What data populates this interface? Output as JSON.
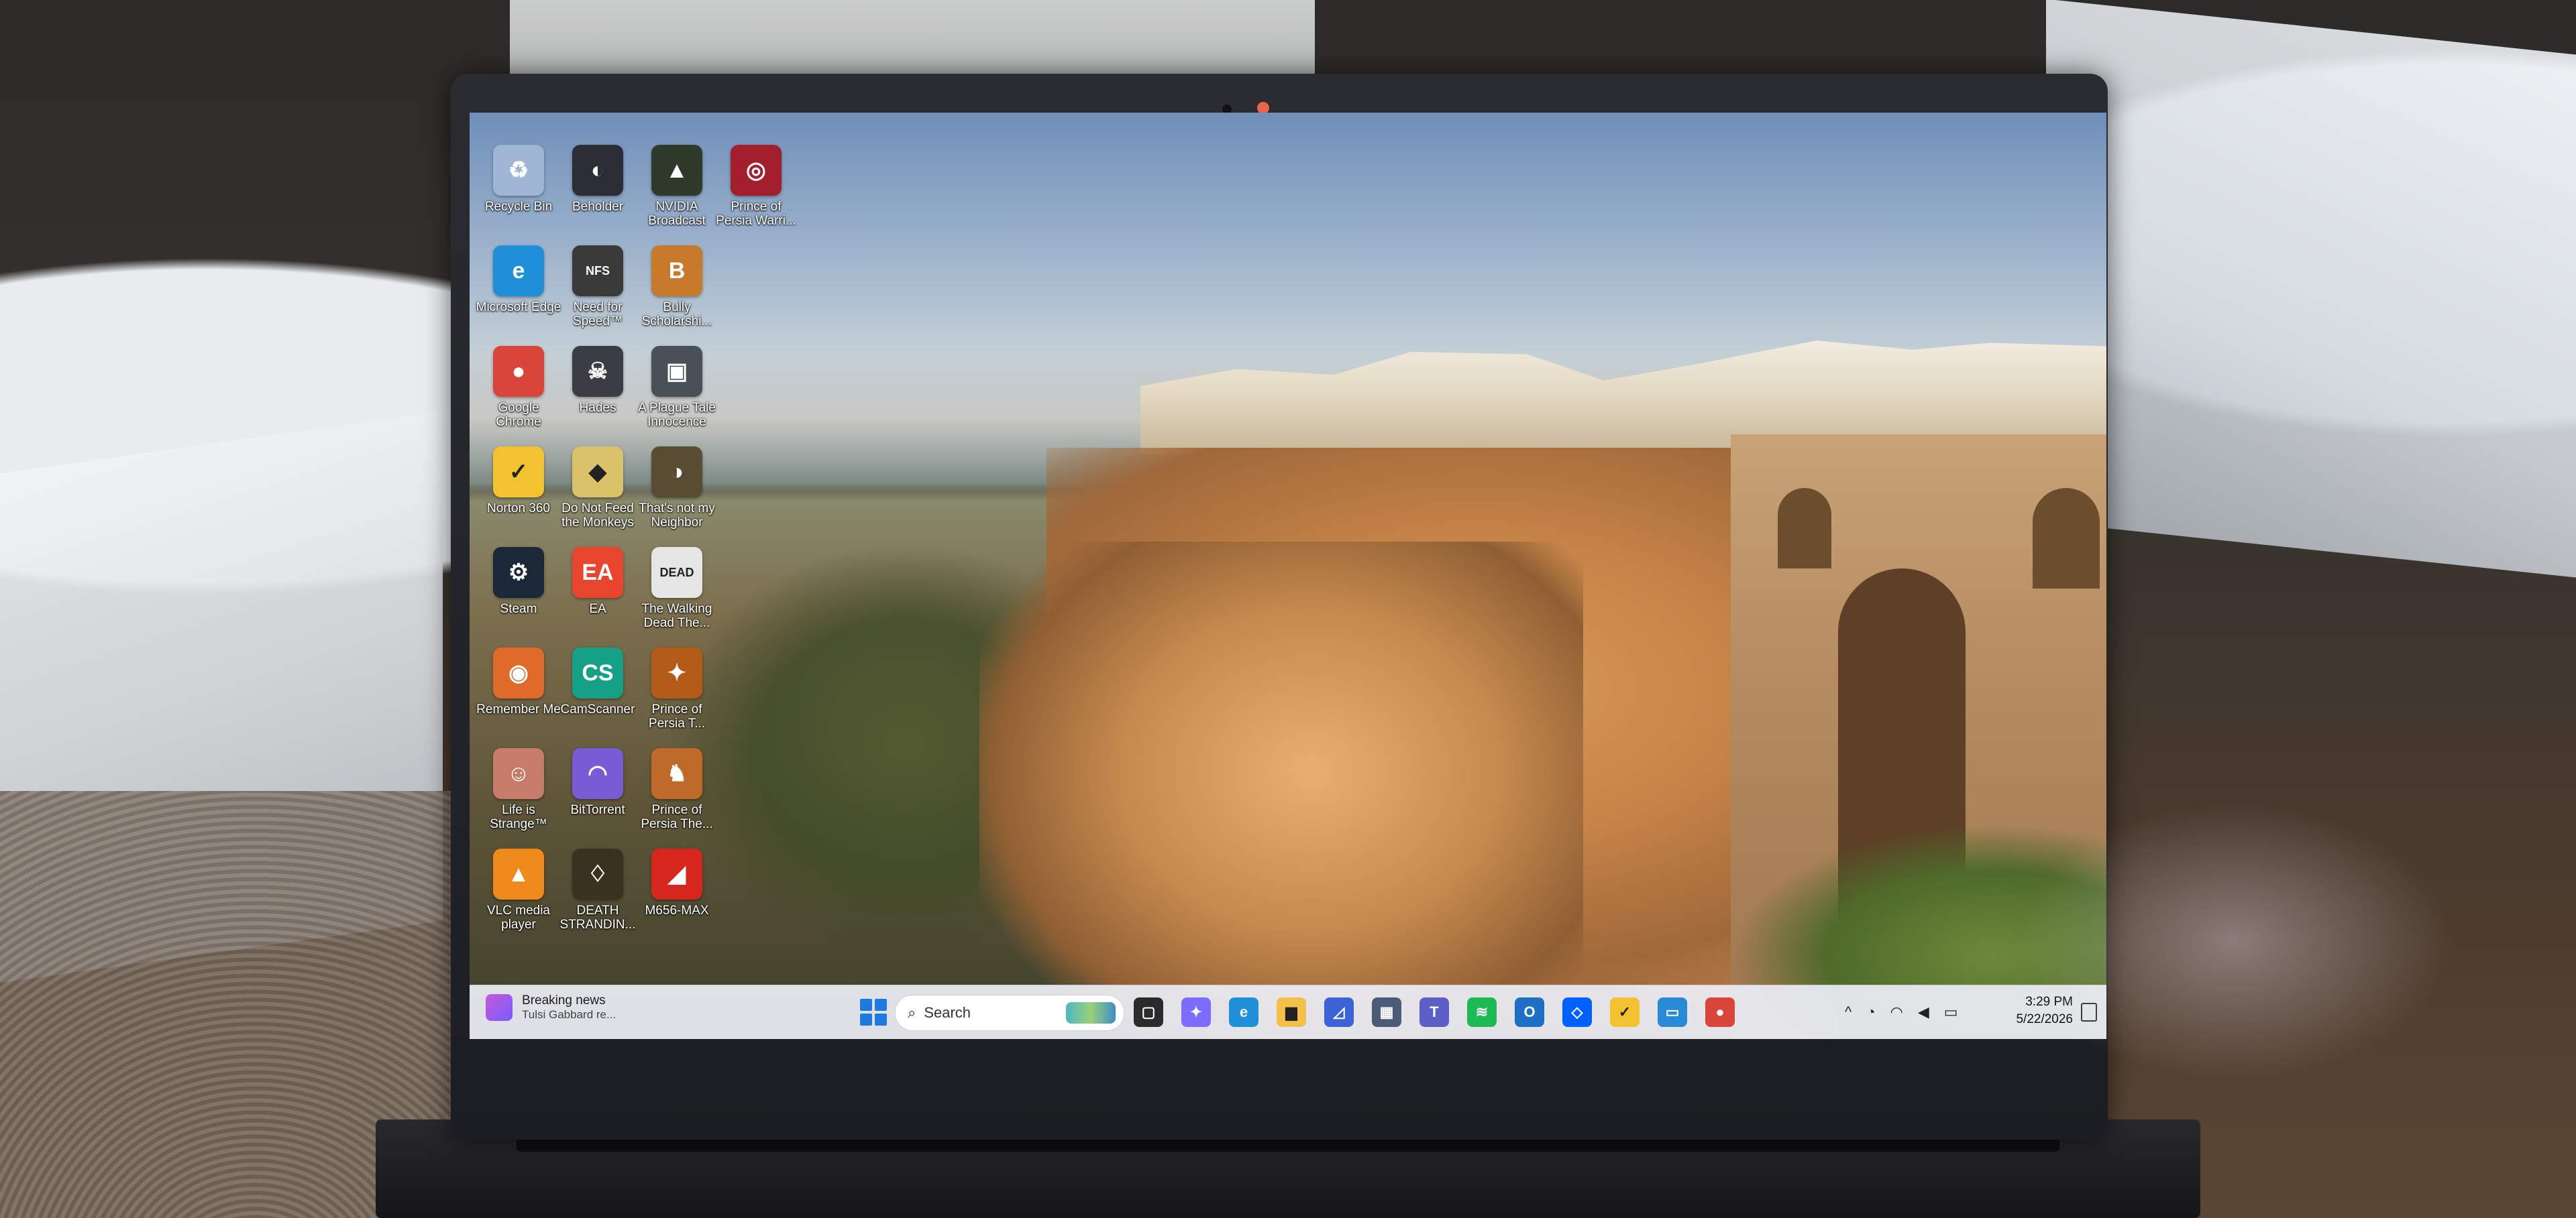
{
  "desktop": {
    "icons": [
      {
        "label": "Recycle Bin",
        "icon": "recycle-bin-icon",
        "color": "#9fb6d4"
      },
      {
        "label": "Beholder",
        "icon": "beholder-icon",
        "color": "#2a2d33"
      },
      {
        "label": "NVIDIA Broadcast",
        "icon": "nvidia-broadcast-icon",
        "color": "#2f3a2a"
      },
      {
        "label": "Prince of Persia Warri...",
        "icon": "prince-of-persia-icon",
        "color": "#a31f2e"
      },
      {
        "label": "Microsoft Edge",
        "icon": "edge-icon",
        "color": "#1e8fd8"
      },
      {
        "label": "Need for Speed™",
        "icon": "need-for-speed-icon",
        "color": "#3b3a3a"
      },
      {
        "label": "Bully Scholarshi...",
        "icon": "bully-icon",
        "color": "#c67a2a"
      },
      {
        "label": "Google Chrome",
        "icon": "chrome-icon",
        "color": "#d9453a"
      },
      {
        "label": "Hades",
        "icon": "hades-icon",
        "color": "#3c3c45"
      },
      {
        "label": "A Plague Tale Innocence",
        "icon": "plague-tale-icon",
        "color": "#4a5058"
      },
      {
        "label": "Norton 360",
        "icon": "norton-icon",
        "color": "#f2c230"
      },
      {
        "label": "Do Not Feed the Monkeys",
        "icon": "monkeys-icon",
        "color": "#d9c26a"
      },
      {
        "label": "That's not my Neighbor",
        "icon": "neighbor-icon",
        "color": "#5a4c33"
      },
      {
        "label": "Steam",
        "icon": "steam-icon",
        "color": "#1b2838"
      },
      {
        "label": "EA",
        "icon": "ea-icon",
        "color": "#e9452e"
      },
      {
        "label": "The Walking Dead The...",
        "icon": "walking-dead-icon",
        "color": "#e6e6e6"
      },
      {
        "label": "Remember Me",
        "icon": "remember-me-icon",
        "color": "#e06a2a"
      },
      {
        "label": "CamScanner",
        "icon": "camscanner-icon",
        "color": "#16a085"
      },
      {
        "label": "Prince of Persia T...",
        "icon": "prince-of-persia-t-icon",
        "color": "#b45b1a"
      },
      {
        "label": "Life is Strange™",
        "icon": "life-is-strange-icon",
        "color": "#c77b6a"
      },
      {
        "label": "BitTorrent",
        "icon": "bittorrent-icon",
        "color": "#7a5bd6"
      },
      {
        "label": "Prince of Persia The...",
        "icon": "prince-of-persia-the-icon",
        "color": "#c06a2a"
      },
      {
        "label": "VLC media player",
        "icon": "vlc-icon",
        "color": "#f08a1c"
      },
      {
        "label": "DEATH STRANDIN...",
        "icon": "death-stranding-icon",
        "color": "#3b3120"
      },
      {
        "label": "M656-MAX",
        "icon": "m656-max-icon",
        "color": "#d7261e"
      }
    ],
    "icon_glyphs": [
      "♻",
      "◐",
      "▲",
      "◎",
      "e",
      "NFS",
      "B",
      "●",
      "☠",
      "▣",
      "✓",
      "◆",
      "◑",
      "⚙",
      "EA",
      "DEAD",
      "◉",
      "CS",
      "✦",
      "☺",
      "◠",
      "♞",
      "▲",
      "♢",
      "◢"
    ]
  },
  "taskbar": {
    "news_title": "Breaking news",
    "news_subtitle": "Tulsi Gabbard re...",
    "search_placeholder": "Search",
    "apps": [
      {
        "name": "task-view-icon",
        "color": "#2b2b2b",
        "glyph": "▢"
      },
      {
        "name": "copilot-icon",
        "color": "#7c6cff",
        "glyph": "✦"
      },
      {
        "name": "edge-icon",
        "color": "#1e8fd8",
        "glyph": "e"
      },
      {
        "name": "file-explorer-icon",
        "color": "#f4c04a",
        "glyph": "▆"
      },
      {
        "name": "app-icon",
        "color": "#3b63d6",
        "glyph": "◿"
      },
      {
        "name": "store-icon",
        "color": "#4b5c78",
        "glyph": "▦"
      },
      {
        "name": "teams-icon",
        "color": "#5b5fc7",
        "glyph": "T"
      },
      {
        "name": "spotify-icon",
        "color": "#1db954",
        "glyph": "≋"
      },
      {
        "name": "outlook-icon",
        "color": "#1f6fc6",
        "glyph": "O"
      },
      {
        "name": "dropbox-icon",
        "color": "#0061fe",
        "glyph": "◇"
      },
      {
        "name": "norton-icon",
        "color": "#f2c230",
        "glyph": "✓"
      },
      {
        "name": "remote-icon",
        "color": "#2a8ad8",
        "glyph": "▭"
      },
      {
        "name": "chrome-icon",
        "color": "#d9453a",
        "glyph": "●"
      }
    ],
    "tray": {
      "chevron": "^",
      "time": "3:29 PM",
      "date": "5/22/2026"
    }
  }
}
